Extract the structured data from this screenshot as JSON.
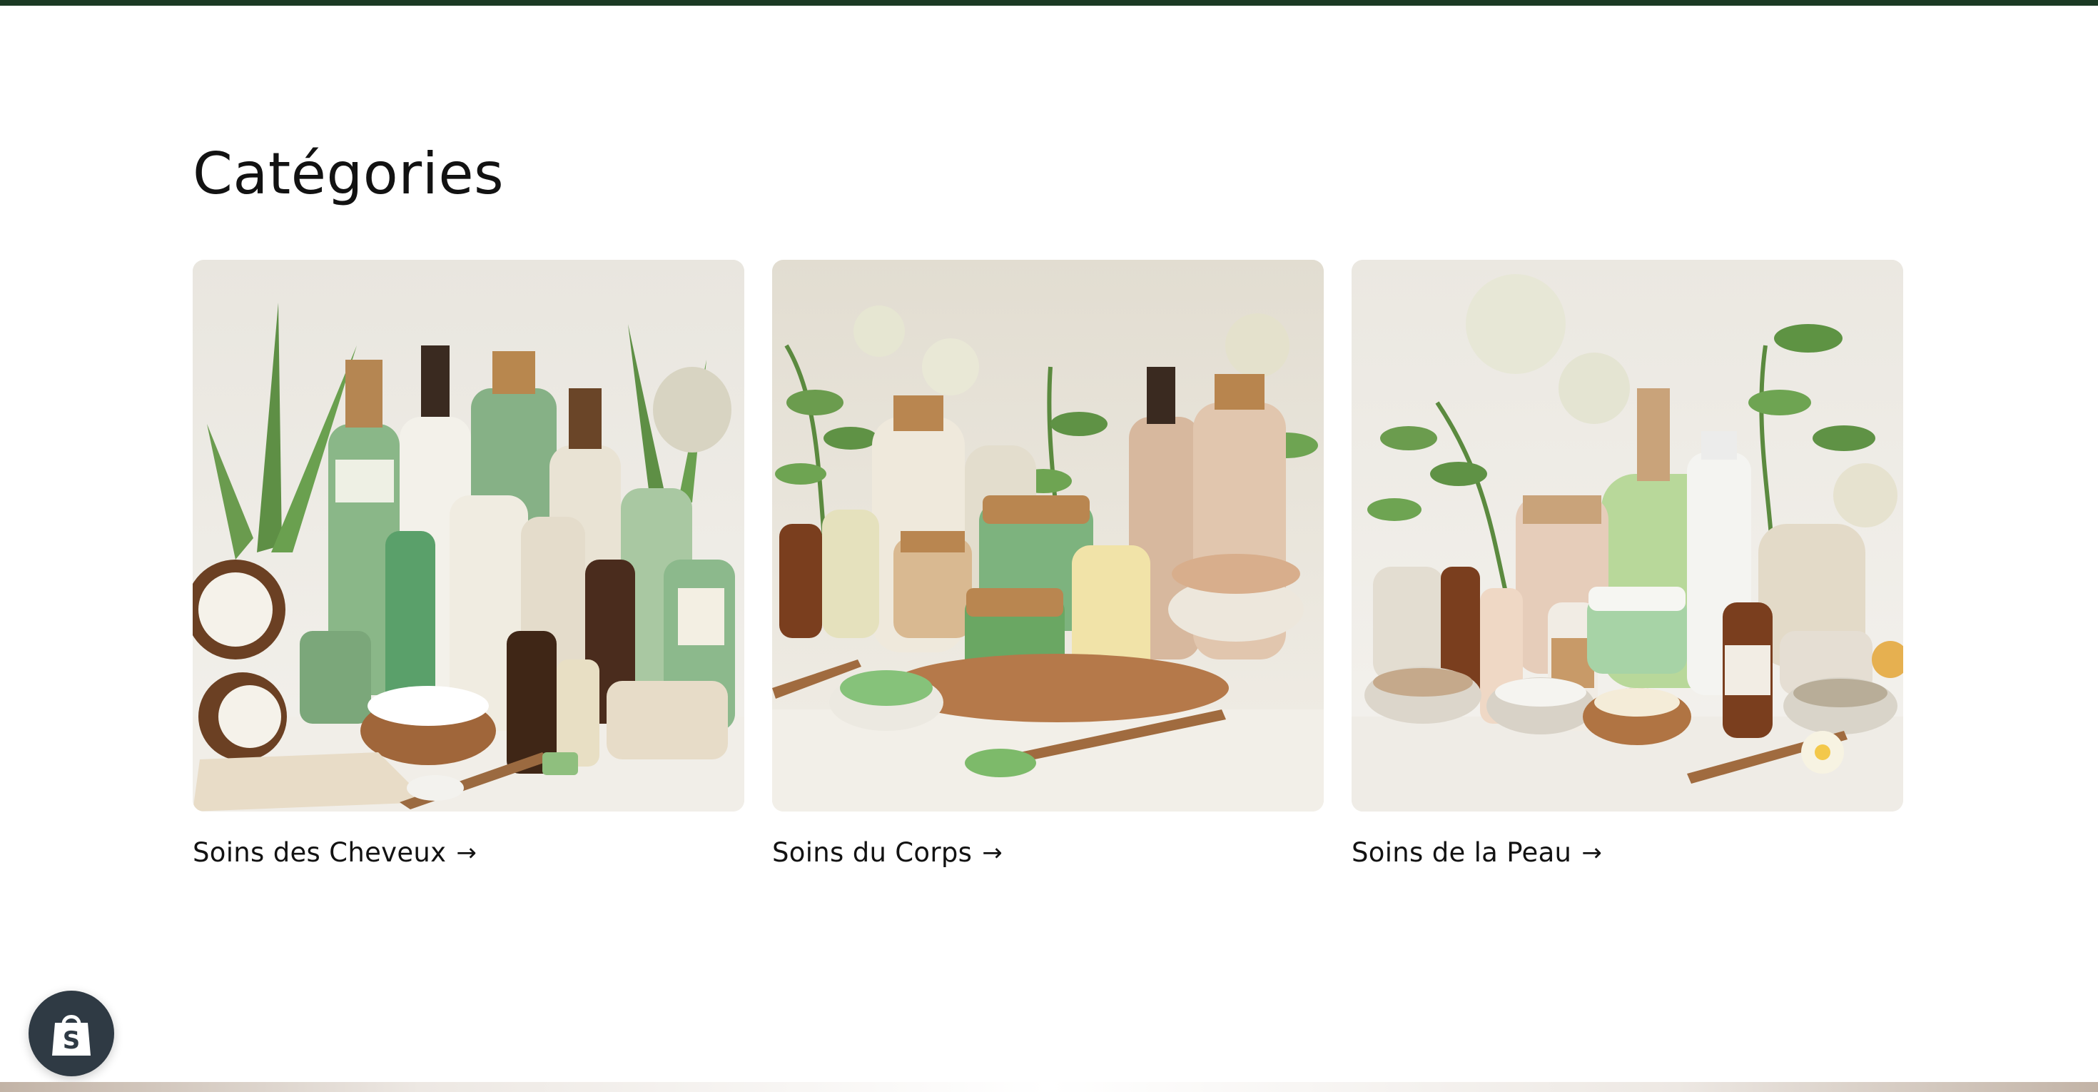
{
  "section": {
    "title": "Catégories"
  },
  "categories": [
    {
      "label": "Soins des Cheveux",
      "image": "hair-care-products-image"
    },
    {
      "label": "Soins du Corps",
      "image": "body-care-products-image"
    },
    {
      "label": "Soins de la Peau",
      "image": "skin-care-products-image"
    }
  ],
  "icons": {
    "link_arrow": "arrow-right-icon",
    "shop_badge": "shopify-bag-icon"
  },
  "colors": {
    "top_bar": "#1b3a24",
    "text": "#121212",
    "badge": "#2f3a44"
  }
}
